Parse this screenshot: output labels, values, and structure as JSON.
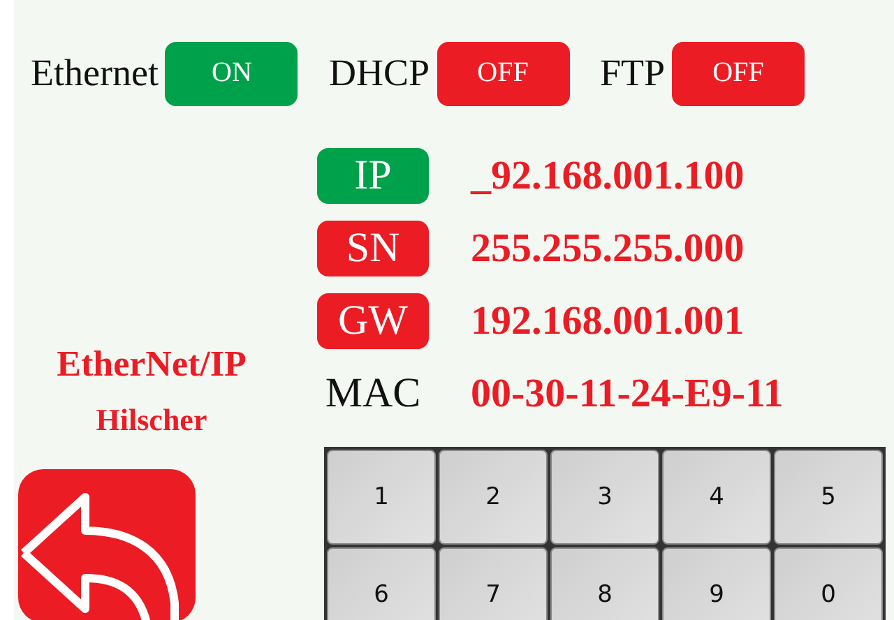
{
  "toggles": [
    {
      "label": "Ethernet",
      "state": "ON",
      "on": true
    },
    {
      "label": "DHCP",
      "state": "OFF",
      "on": false
    },
    {
      "label": "FTP",
      "state": "OFF",
      "on": false
    }
  ],
  "device": {
    "protocol": "EtherNet/IP",
    "vendor": "Hilscher"
  },
  "fields": [
    {
      "label": "IP",
      "kind": "badge",
      "color": "#00a14b",
      "value": "_92.168.001.100"
    },
    {
      "label": "SN",
      "kind": "badge",
      "color": "#ec1c24",
      "value": "255.255.255.000"
    },
    {
      "label": "GW",
      "kind": "badge",
      "color": "#ec1c24",
      "value": "192.168.001.001"
    },
    {
      "label": "MAC",
      "kind": "plain",
      "value": "00-30-11-24-E9-11"
    }
  ],
  "keypad": [
    "1",
    "2",
    "3",
    "4",
    "5",
    "6",
    "7",
    "8",
    "9",
    "0"
  ]
}
